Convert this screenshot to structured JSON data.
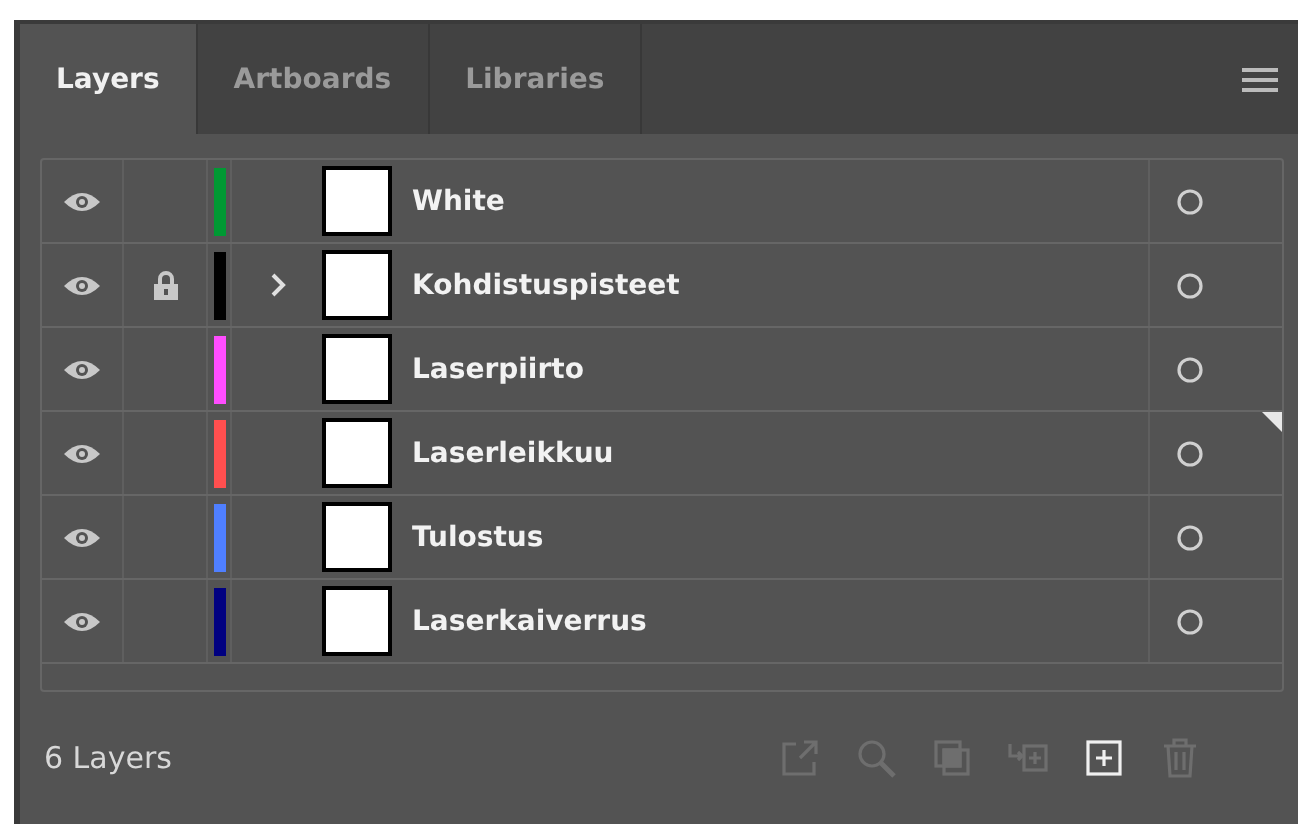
{
  "tabs": [
    {
      "label": "Layers",
      "selected": true
    },
    {
      "label": "Artboards",
      "selected": false
    },
    {
      "label": "Libraries",
      "selected": false
    }
  ],
  "layers": [
    {
      "name": "White",
      "color": "#009933",
      "visible": true,
      "locked": false,
      "has_children": false,
      "current": false
    },
    {
      "name": "Kohdistuspisteet",
      "color": "#000000",
      "visible": true,
      "locked": true,
      "has_children": true,
      "current": false
    },
    {
      "name": "Laserpiirto",
      "color": "#ff4dff",
      "visible": true,
      "locked": false,
      "has_children": false,
      "current": false
    },
    {
      "name": "Laserleikkuu",
      "color": "#ff4f4f",
      "visible": true,
      "locked": false,
      "has_children": false,
      "current": true
    },
    {
      "name": "Tulostus",
      "color": "#4f7fff",
      "visible": true,
      "locked": false,
      "has_children": false,
      "current": false
    },
    {
      "name": "Laserkaiverrus",
      "color": "#000080",
      "visible": true,
      "locked": false,
      "has_children": false,
      "current": false
    }
  ],
  "status": "6 Layers",
  "footer_buttons": [
    {
      "kind": "export",
      "disabled": true
    },
    {
      "kind": "search",
      "disabled": true
    },
    {
      "kind": "mask",
      "disabled": true
    },
    {
      "kind": "move",
      "disabled": true
    },
    {
      "kind": "new",
      "disabled": false
    },
    {
      "kind": "delete",
      "disabled": true
    }
  ]
}
